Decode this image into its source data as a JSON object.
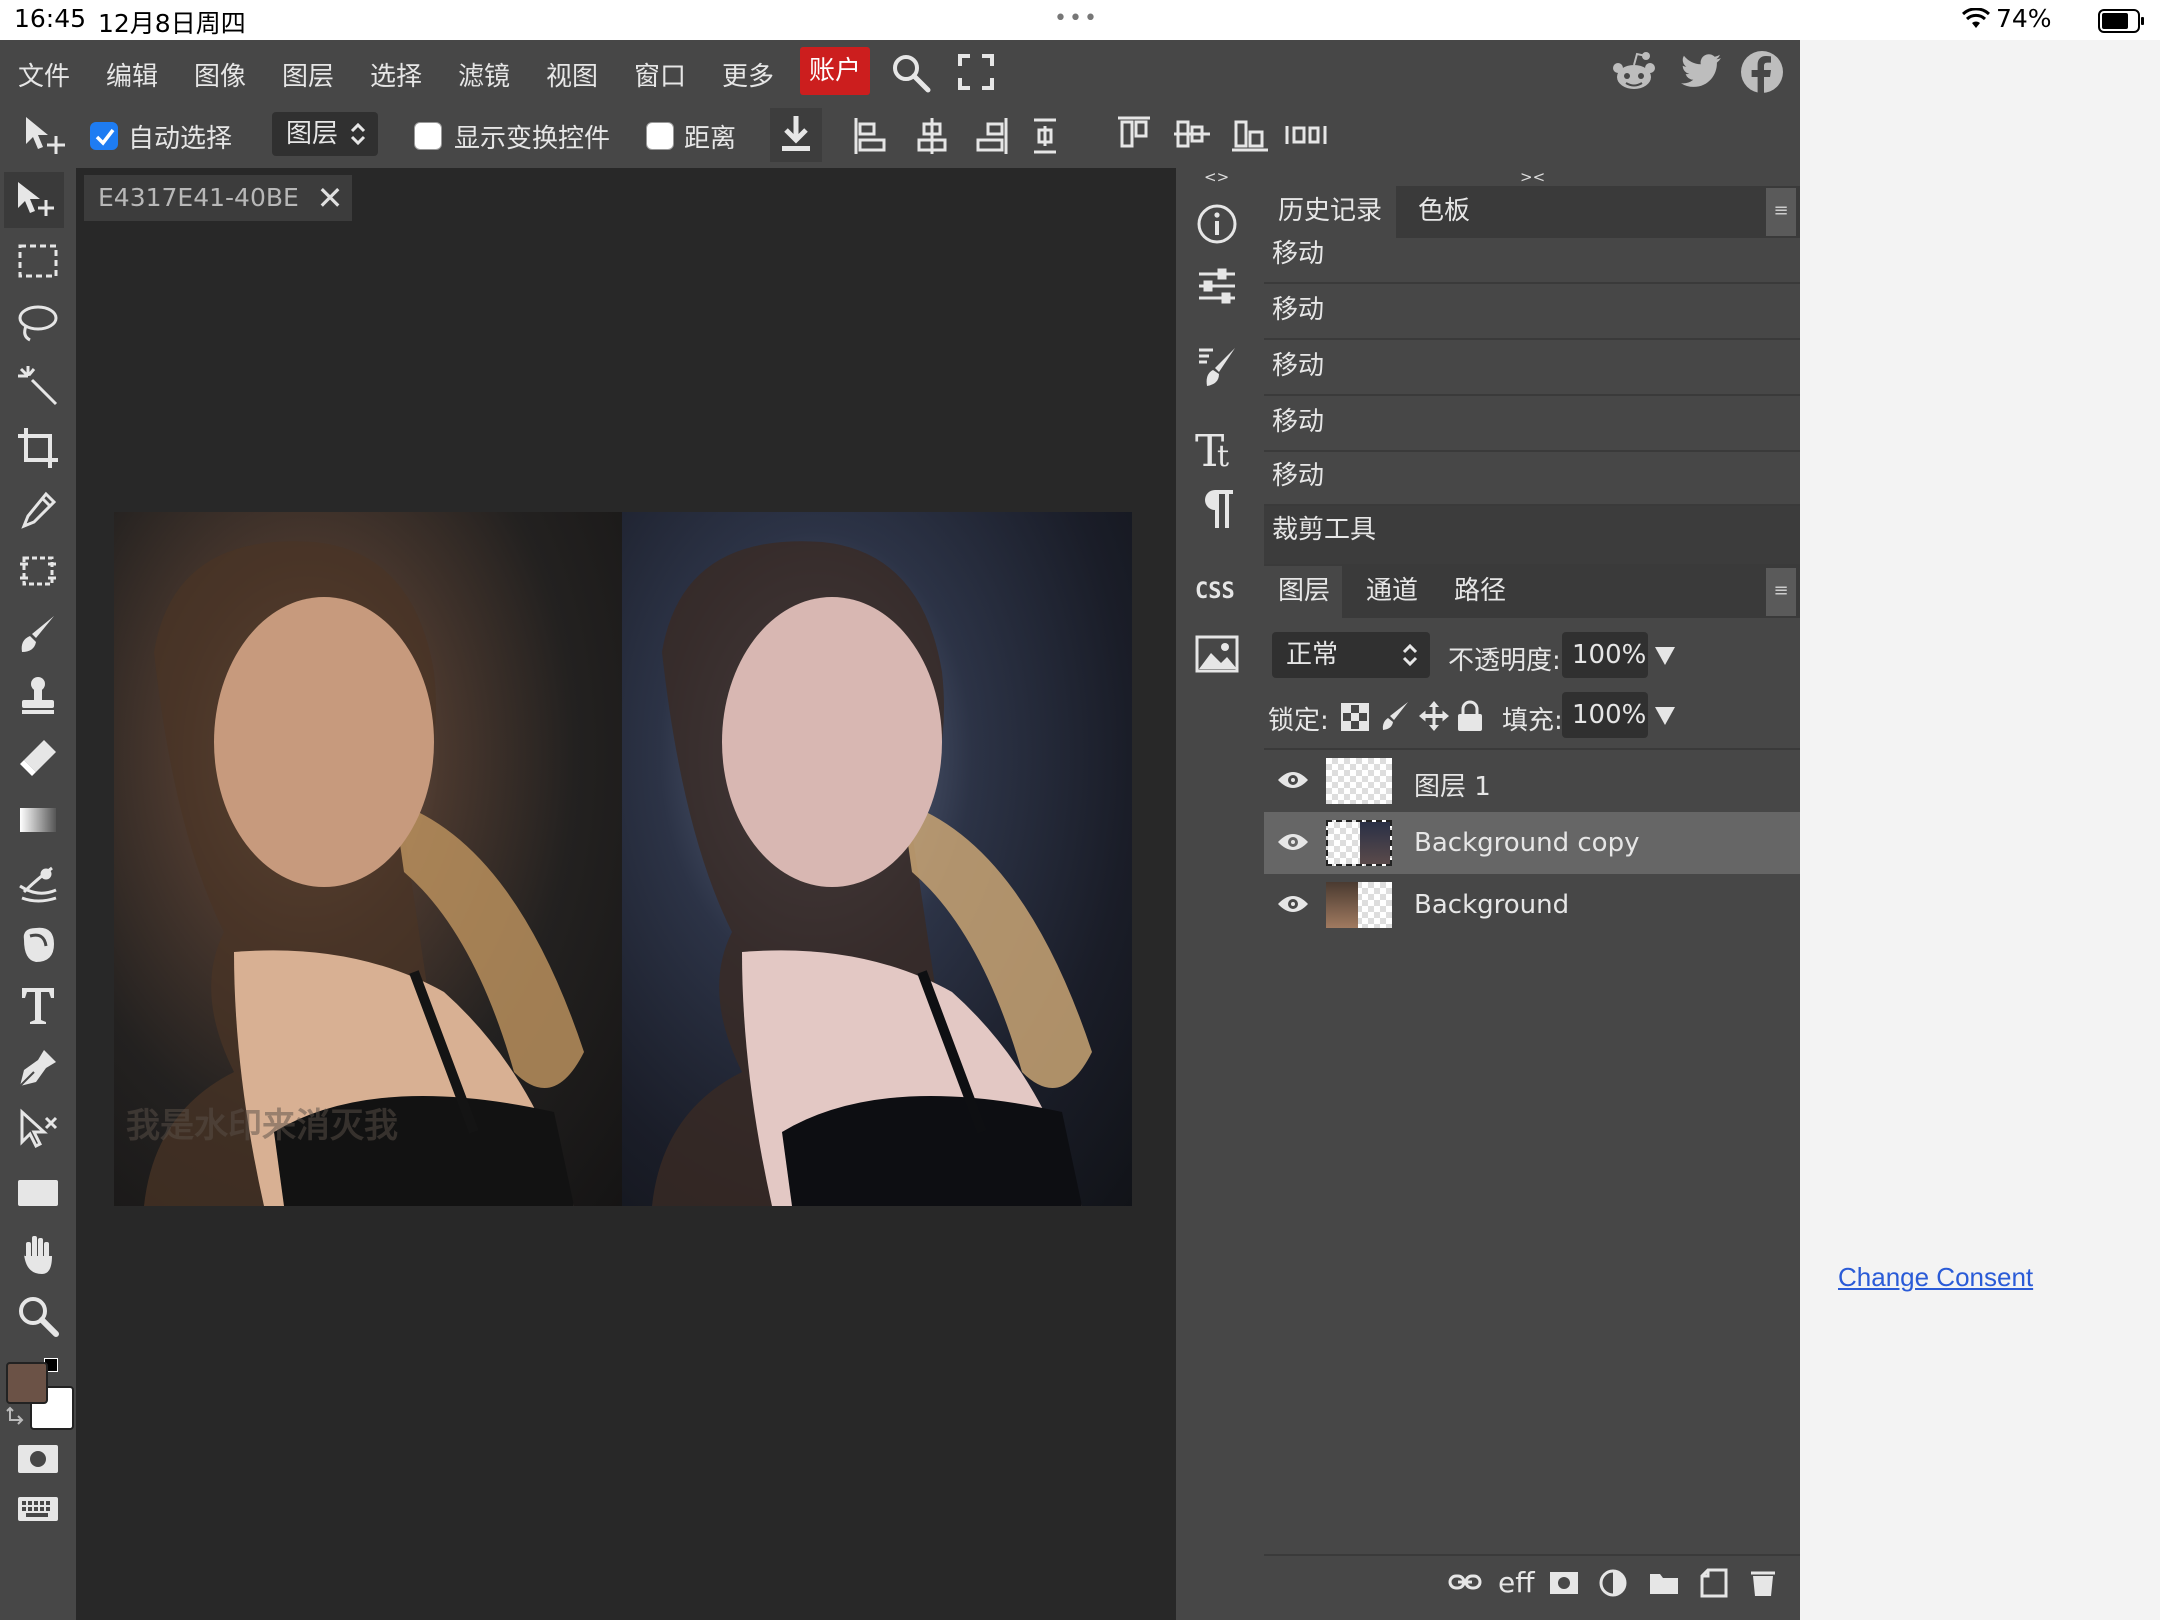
{
  "status_bar": {
    "time": "16:45",
    "date": "12月8日周四",
    "dots": "•••",
    "battery": "74%"
  },
  "menu": [
    "文件",
    "编辑",
    "图像",
    "图层",
    "选择",
    "滤镜",
    "视图",
    "窗口",
    "更多"
  ],
  "account": "账户",
  "options_bar": {
    "auto_select_label": "自动选择",
    "auto_select_checked": true,
    "target_select": "图层",
    "show_transform_label": "显示变换控件",
    "distance_label": "距离"
  },
  "document_tab": {
    "title": "E4317E41-40BE",
    "close": "✕"
  },
  "panel_collapse_left": "<>",
  "panel_collapse_right": "><",
  "history_panel": {
    "tabs": [
      "历史记录",
      "色板"
    ],
    "items": [
      "移动",
      "移动",
      "移动",
      "移动",
      "移动",
      "裁剪工具"
    ],
    "selected_index": 5
  },
  "layers_panel": {
    "tabs": [
      "图层",
      "通道",
      "路径"
    ],
    "blend_mode": "正常",
    "opacity_label": "不透明度:",
    "opacity_value": "100%",
    "lock_label": "锁定:",
    "fill_label": "填充:",
    "fill_value": "100%",
    "layers": [
      {
        "name": "图层 1",
        "visible": true,
        "selected": false
      },
      {
        "name": "Background copy",
        "visible": true,
        "selected": true
      },
      {
        "name": "Background",
        "visible": true,
        "selected": false
      }
    ],
    "footer_eff": "eff"
  },
  "colors": {
    "foreground": "#6b5246",
    "background": "#ffffff",
    "account_red": "#cc1e1e",
    "link": "#2a5bd7"
  },
  "consent_link": "Change Consent",
  "watermark": "我是水印来消灭我"
}
